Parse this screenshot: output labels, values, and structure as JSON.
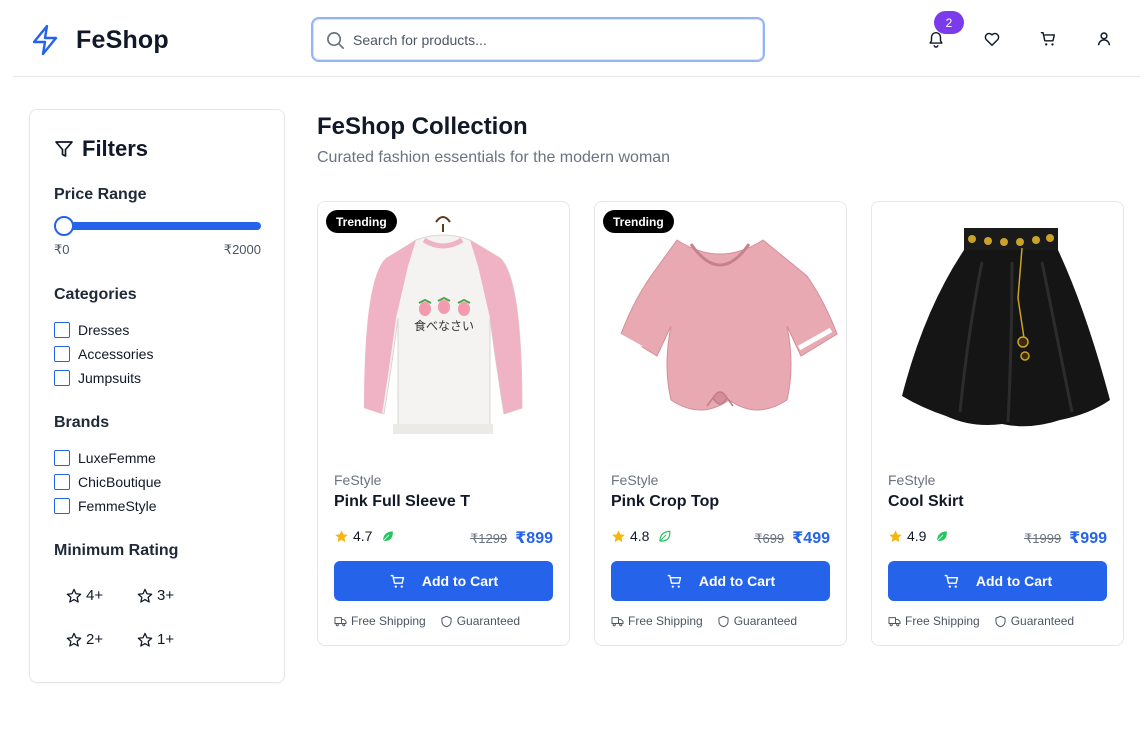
{
  "header": {
    "logo_text": "FeShop",
    "search_placeholder": "Search for products...",
    "notification_count": "2"
  },
  "sidebar": {
    "title": "Filters",
    "price_range": {
      "title": "Price Range",
      "min_label": "₹0",
      "max_label": "₹2000",
      "selected_min_fraction": 0
    },
    "categories": {
      "title": "Categories",
      "items": [
        "Dresses",
        "Accessories",
        "Jumpsuits"
      ]
    },
    "brands": {
      "title": "Brands",
      "items": [
        "LuxeFemme",
        "ChicBoutique",
        "FemmeStyle"
      ]
    },
    "min_rating": {
      "title": "Minimum Rating",
      "options": [
        "4+",
        "3+",
        "2+",
        "1+"
      ]
    }
  },
  "main": {
    "title": "FeShop Collection",
    "subtitle": "Curated fashion essentials for the modern woman",
    "products": [
      {
        "tag": "Trending",
        "brand": "FeStyle",
        "name": "Pink Full Sleeve T",
        "rating": "4.7",
        "old_price": "₹1299",
        "price": "₹899",
        "button": "Add to Cart",
        "perk1": "Free Shipping",
        "perk2": "Guaranteed"
      },
      {
        "tag": "Trending",
        "brand": "FeStyle",
        "name": "Pink Crop Top",
        "rating": "4.8",
        "old_price": "₹699",
        "price": "₹499",
        "button": "Add to Cart",
        "perk1": "Free Shipping",
        "perk2": "Guaranteed"
      },
      {
        "tag": "",
        "brand": "FeStyle",
        "name": "Cool Skirt",
        "rating": "4.9",
        "old_price": "₹1999",
        "price": "₹999",
        "button": "Add to Cart",
        "perk1": "Free Shipping",
        "perk2": "Guaranteed"
      }
    ]
  },
  "colors": {
    "accent": "#2563eb",
    "badge": "#7c3aed",
    "star": "#f5b50a",
    "eco": "#22c55e"
  }
}
